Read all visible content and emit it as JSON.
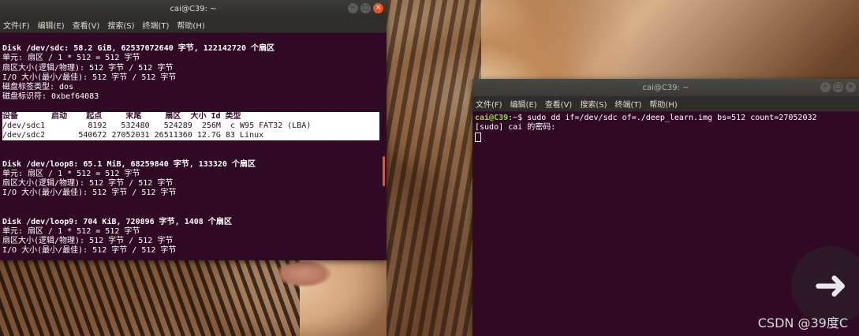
{
  "left_window": {
    "title": "cai@C39: ~",
    "menu": [
      "文件(F)",
      "编辑(E)",
      "查看(V)",
      "搜索(S)",
      "终端(T)",
      "帮助(H)"
    ],
    "lines": [
      {
        "text": "",
        "style": "normal"
      },
      {
        "text": "Disk /dev/sdc: 58.2 GiB, 62537072640 字节, 122142720 个扇区",
        "style": "bold"
      },
      {
        "text": "单元: 扇区 / 1 * 512 = 512 字节",
        "style": "normal"
      },
      {
        "text": "扇区大小(逻辑/物理): 512 字节 / 512 字节",
        "style": "normal"
      },
      {
        "text": "I/O 大小(最小/最佳): 512 字节 / 512 字节",
        "style": "normal"
      },
      {
        "text": "磁盘标签类型: dos",
        "style": "normal"
      },
      {
        "text": "磁盘标识符: 0xbef64083",
        "style": "normal"
      },
      {
        "text": "",
        "style": "normal"
      },
      {
        "text": "设备       启动    起点     末尾     扇区  大小 Id 类型",
        "style": "hl-bold"
      },
      {
        "text": "/dev/sdc1         8192   532480   524289  256M  c W95 FAT32 (LBA)",
        "style": "hl"
      },
      {
        "text": "/dev/sdc2       540672 27052031 26511360 12.7G 83 Linux",
        "style": "hl"
      },
      {
        "text": "",
        "style": "normal"
      },
      {
        "text": "",
        "style": "normal"
      },
      {
        "text": "Disk /dev/loop8: 65.1 MiB, 68259840 字节, 133320 个扇区",
        "style": "bold"
      },
      {
        "text": "单元: 扇区 / 1 * 512 = 512 字节",
        "style": "normal"
      },
      {
        "text": "扇区大小(逻辑/物理): 512 字节 / 512 字节",
        "style": "normal"
      },
      {
        "text": "I/O 大小(最小/最佳): 512 字节 / 512 字节",
        "style": "normal"
      },
      {
        "text": "",
        "style": "normal"
      },
      {
        "text": "",
        "style": "normal"
      },
      {
        "text": "Disk /dev/loop9: 704 KiB, 720896 字节, 1408 个扇区",
        "style": "bold"
      },
      {
        "text": "单元: 扇区 / 1 * 512 = 512 字节",
        "style": "normal"
      },
      {
        "text": "扇区大小(逻辑/物理): 512 字节 / 512 字节",
        "style": "normal"
      },
      {
        "text": "I/O 大小(最小/最佳): 512 字节 / 512 字节",
        "style": "normal"
      }
    ]
  },
  "right_window": {
    "title": "cai@C39: ~",
    "menu": [
      "文件(F)",
      "编辑(E)",
      "查看(V)",
      "搜索(S)",
      "终端(T)",
      "帮助(H)"
    ],
    "prompt": "cai@C39",
    "prompt_suffix": ":~$ ",
    "command": "sudo dd if=/dev/sdc of=./deep_learn.img bs=512 count=27052032",
    "sudo_prompt": "[sudo] cai 的密码:"
  },
  "overlay": {
    "arrow_icon": "arrow-right-icon",
    "watermark": "CSDN @39度C"
  },
  "colors": {
    "terminal_bg": "#300a24",
    "accent": "#e95420",
    "prompt_green": "#8ae234"
  }
}
